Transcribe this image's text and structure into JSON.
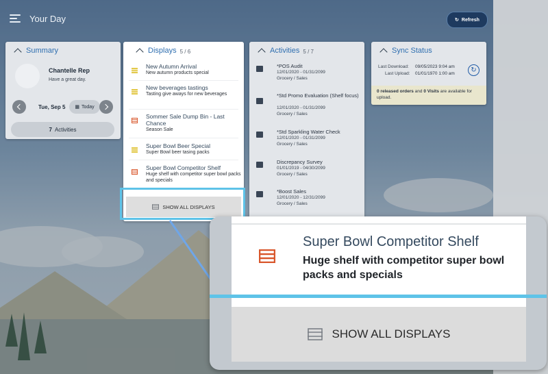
{
  "header": {
    "title": "Your Day",
    "refresh_label": "Refresh"
  },
  "summary": {
    "title": "Summary",
    "user_name": "Chantelle Rep",
    "greeting": "Have a great day.",
    "date": "Tue, Sep 5",
    "today_label": "Today",
    "activities_count": "7",
    "activities_label": "Activities"
  },
  "displays": {
    "title": "Displays",
    "count": "5 / 6",
    "items": [
      {
        "title": "New Autumn Arrival",
        "subtitle": "New autumn products special",
        "color": "#e3c94a"
      },
      {
        "title": "New beverages tastings",
        "subtitle": "Tasting give aways for new beverages",
        "color": "#e3c94a"
      },
      {
        "title": "Sommer Sale Dump Bin - Last Chance",
        "subtitle": "Season Sale",
        "color": "#d9572c"
      },
      {
        "title": "Super Bowl Beer Special",
        "subtitle": "Super Bowl beer tasing packs",
        "color": "#e3c94a"
      },
      {
        "title": "Super Bowl Competitor Shelf",
        "subtitle": "Huge shelf with competitor super bowl packs and specials",
        "color": "#d9572c"
      }
    ],
    "show_all_label": "SHOW ALL DISPLAYS"
  },
  "activities": {
    "title": "Activities",
    "count": "5 / 7",
    "items": [
      {
        "title": "*POS Audit",
        "dates": "12/01/2020   -   01/31/2099",
        "category": "Grocery / Sales"
      },
      {
        "title": "*Std Promo Evaluation (Shelf focus)",
        "dates": "12/01/2020   -   01/31/2099",
        "category": "Grocery / Sales"
      },
      {
        "title": "*Std Sparkling Water Check",
        "dates": "12/01/2020   -   01/31/2099",
        "category": "Grocery / Sales"
      },
      {
        "title": "Discrepancy Survey",
        "dates": "01/01/2019   -   04/30/2099",
        "category": "Grocery / Sales"
      },
      {
        "title": "*Boost Sales",
        "dates": "12/01/2020   -   12/31/2099",
        "category": "Grocery / Sales"
      }
    ]
  },
  "sync": {
    "title": "Sync Status",
    "last_download_label": "Last Download:",
    "last_download_value": "09/05/2023 9:04 am",
    "last_upload_label": "Last Upload:",
    "last_upload_value": "01/01/1970 1:00 am",
    "note_orders": "0 released orders",
    "note_and": " and ",
    "note_visits": "0 Visits",
    "note_tail": " are available for upload."
  },
  "zoom": {
    "item_title": "Super Bowl Competitor Shelf",
    "item_subtitle": "Huge shelf with competitor super bowl packs and specials",
    "show_all_label": "SHOW ALL DISPLAYS"
  }
}
